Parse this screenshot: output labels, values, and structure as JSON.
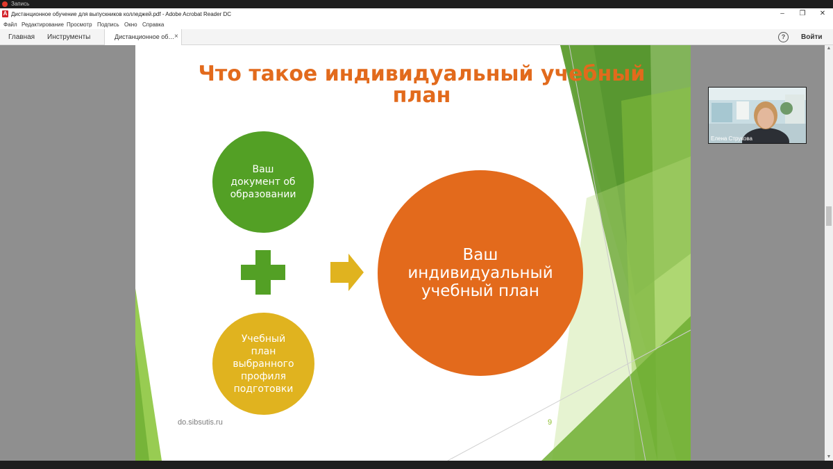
{
  "recording": {
    "label": "Запись"
  },
  "window": {
    "title": "Дистанционное обучение для выпускников колледжей.pdf - Adobe Acrobat Reader DC",
    "app_icon": "acrobat-icon",
    "controls": {
      "minimize": "–",
      "restore": "❐",
      "close": "✕"
    }
  },
  "menu": [
    "Файл",
    "Редактирование",
    "Просмотр",
    "Подпись",
    "Окно",
    "Справка"
  ],
  "tabs": {
    "home": "Главная",
    "tools": "Инструменты",
    "document": "Дистанционное об…",
    "close": "×"
  },
  "toolbar_right": {
    "help_icon": "?",
    "signin": "Войти"
  },
  "slide": {
    "title_line1": "Что такое индивидуальный учебный",
    "title_line2": "план",
    "circle_doc": {
      "line1": "Ваш",
      "line2": "документ об",
      "line3": "образовании",
      "color": "#53a025"
    },
    "circle_curriculum": {
      "line1": "Учебный",
      "line2": "план",
      "line3": "выбранного",
      "line4": "профиля",
      "line5": "подготовки",
      "color": "#e0b31f"
    },
    "circle_result": {
      "line1": "Ваш",
      "line2": "индивидуальный",
      "line3": "учебный план",
      "color": "#e36a1c"
    },
    "plus_color": "#53a025",
    "arrow_color": "#e0b31f",
    "footer_url": "do.sibsutis.ru",
    "page_number": "9"
  },
  "webcam": {
    "participant_name": "Елена Струкова"
  },
  "colors": {
    "accent_orange": "#e26a1c",
    "green_dark": "#5a9a2d",
    "green_light": "#8dc63f"
  }
}
